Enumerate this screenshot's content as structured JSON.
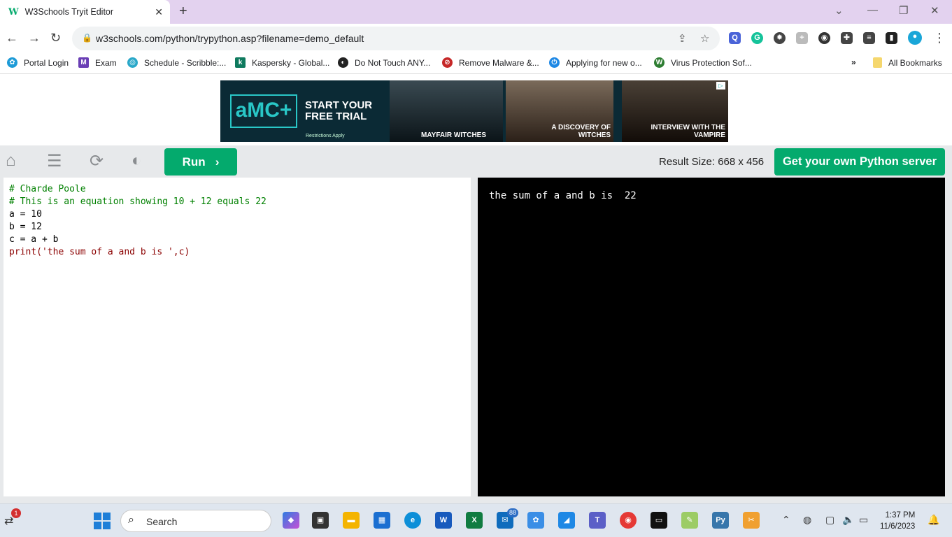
{
  "browser": {
    "tab_title": "W3Schools Tryit Editor",
    "tab_favicon": "w3schools-logo",
    "url": "w3schools.com/python/trypython.asp?filename=demo_default"
  },
  "bookmarks": [
    {
      "label": "Portal Login",
      "icon": "portal-icon"
    },
    {
      "label": "Exam",
      "icon": "exam-icon"
    },
    {
      "label": "Schedule - Scribble:...",
      "icon": "schedule-icon"
    },
    {
      "label": "Kaspersky - Global...",
      "icon": "kaspersky-icon"
    },
    {
      "label": "Do Not Touch ANY...",
      "icon": "globe-icon"
    },
    {
      "label": "Remove Malware &...",
      "icon": "malware-icon"
    },
    {
      "label": "Applying for new o...",
      "icon": "power-icon"
    },
    {
      "label": "Virus Protection Sof...",
      "icon": "w-icon"
    }
  ],
  "bookmarks_more": "»",
  "all_bookmarks": "All Bookmarks",
  "ad": {
    "brand": "aMC+",
    "cta": "START YOUR FREE TRIAL",
    "restrictions": "Restrictions Apply",
    "panel1": "MAYFAIR WITCHES",
    "panel2": "A DISCOVERY OF WITCHES",
    "panel3": "INTERVIEW WITH THE VAMPIRE"
  },
  "tryit": {
    "run_label": "Run",
    "result_size": "Result Size: 668 x 456",
    "get_server": "Get your own Python server"
  },
  "code_lines": [
    "# Charde Poole",
    "# This is an equation showing 10 + 12 equals 22",
    "a = 10",
    "b = 12",
    "c = a + b",
    "print('the sum of a and b is ',c)"
  ],
  "output": "the sum of a and b is  22",
  "taskbar": {
    "search_placeholder": "Search",
    "notification_count": "1",
    "mail_badge": "88",
    "time": "1:37 PM",
    "date": "11/6/2023"
  },
  "colors": {
    "accent": "#04aa6d",
    "tab_strip": "#e3d2ef",
    "result_bg": "#000000"
  }
}
